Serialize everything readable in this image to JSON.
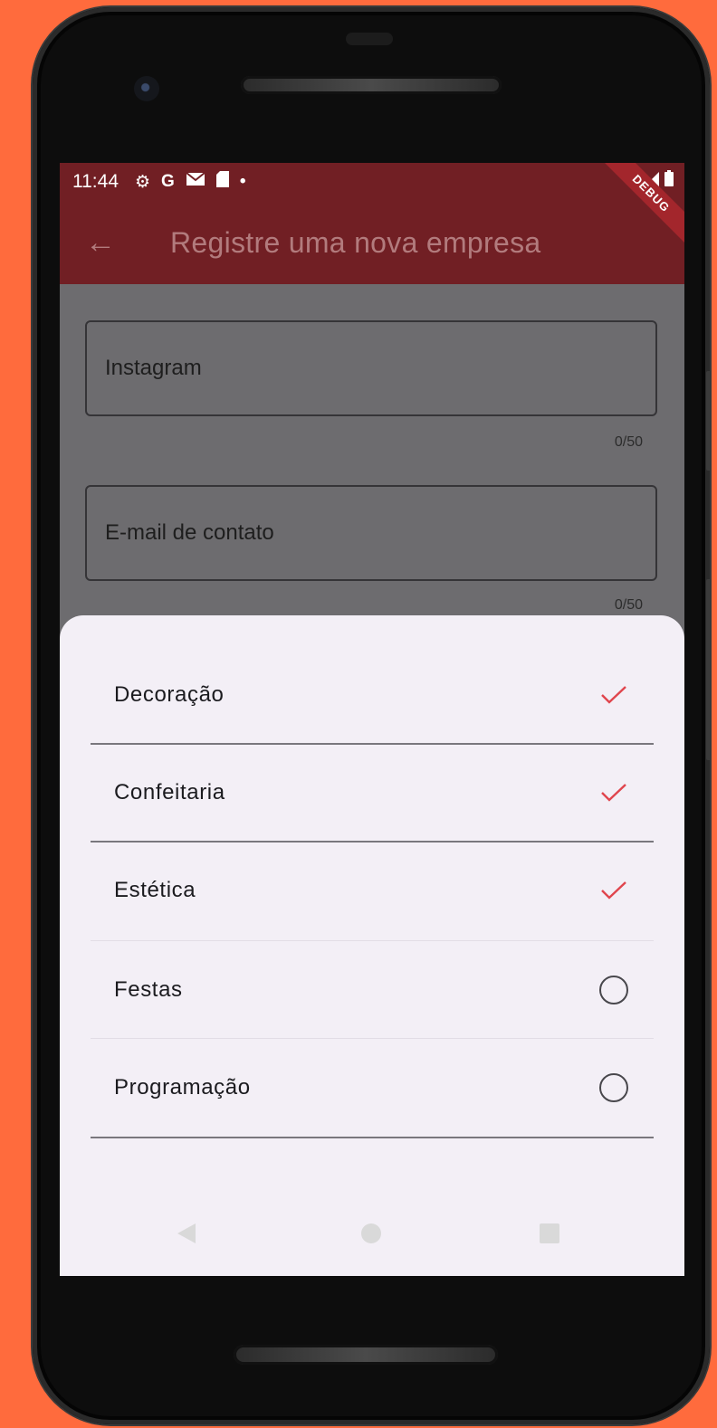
{
  "status_bar": {
    "time": "11:44",
    "icons": [
      "gear-icon",
      "google-icon",
      "gmail-icon",
      "sd-card-icon",
      "dot-icon"
    ],
    "right_icons": [
      "wifi-icon",
      "signal-icon",
      "battery-icon"
    ]
  },
  "debug_banner": "DEBUG",
  "app_bar": {
    "back_icon": "←",
    "title": "Registre uma nova empresa"
  },
  "form": {
    "instagram": {
      "placeholder": "Instagram",
      "counter": "0/50"
    },
    "email": {
      "placeholder": "E-mail de contato",
      "counter": "0/50"
    }
  },
  "sheet": {
    "options": [
      {
        "label": "Decoração",
        "selected": true
      },
      {
        "label": "Confeitaria",
        "selected": true
      },
      {
        "label": "Estética",
        "selected": true
      },
      {
        "label": "Festas",
        "selected": false
      },
      {
        "label": "Programação",
        "selected": false
      }
    ]
  },
  "colors": {
    "accent": "#e0454d",
    "app_bar": "#711f24",
    "sheet_bg": "#f3eff6",
    "scrim": "#6d6c6f"
  }
}
